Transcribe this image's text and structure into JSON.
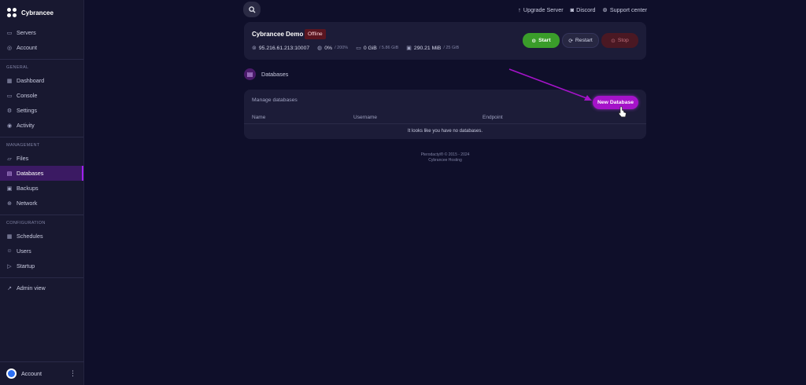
{
  "brand": {
    "name": "Cybrancee"
  },
  "sidebar": {
    "top_items": [
      {
        "label": "Servers",
        "icon": "server-icon"
      },
      {
        "label": "Account",
        "icon": "user-icon"
      }
    ],
    "sections": {
      "general": "GENERAL",
      "management": "MANAGEMENT",
      "configuration": "CONFIGURATION"
    },
    "general_items": [
      {
        "label": "Dashboard"
      },
      {
        "label": "Console"
      },
      {
        "label": "Settings"
      },
      {
        "label": "Activity"
      }
    ],
    "management_items": [
      {
        "label": "Files"
      },
      {
        "label": "Databases",
        "active": true
      },
      {
        "label": "Backups"
      },
      {
        "label": "Network"
      }
    ],
    "configuration_items": [
      {
        "label": "Schedules"
      },
      {
        "label": "Users"
      },
      {
        "label": "Startup"
      }
    ],
    "admin_view": "Admin view",
    "account_label": "Account"
  },
  "topbar": {
    "links": [
      "Upgrade Server",
      "Discord",
      "Support center"
    ]
  },
  "server": {
    "name": "Cybrancee Demo",
    "status": "Offline",
    "address": "95.216.61.213:10007",
    "cpu": "0%",
    "cpu_limit": "/ 200%",
    "memory": "0 GiB",
    "memory_limit": "/ 5.86 GiB",
    "disk": "290.21 MiB",
    "disk_limit": "/ 25 GiB",
    "buttons": {
      "start": "Start",
      "restart": "Restart",
      "stop": "Stop"
    }
  },
  "databases": {
    "title": "Databases",
    "manage_label": "Manage databases",
    "new_button": "New Database",
    "columns": [
      "Name",
      "Username",
      "Endpoint"
    ],
    "empty_message": "It looks like you have no databases."
  },
  "footer": {
    "line1": "Pterodactyl® © 2015 - 2024",
    "line2": "Cybrancee Hosting"
  },
  "colors": {
    "background": "#0f0f2a",
    "accent": "#a513c9",
    "start": "#3a9d2a",
    "offline_badge": "#5a1520"
  }
}
